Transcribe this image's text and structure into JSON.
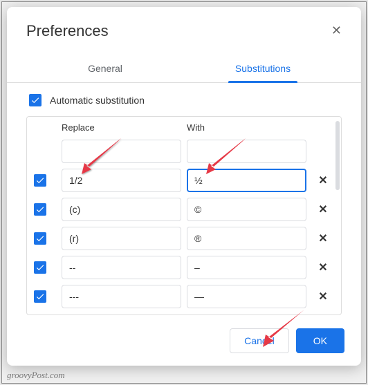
{
  "dialog": {
    "title": "Preferences"
  },
  "tabs": {
    "general": "General",
    "substitutions": "Substitutions"
  },
  "autoSubLabel": "Automatic substitution",
  "headers": {
    "replace": "Replace",
    "with": "With"
  },
  "rows": [
    {
      "enabled": false,
      "replace": "",
      "with": "",
      "deletable": false
    },
    {
      "enabled": true,
      "replace": "1/2",
      "with": "½",
      "deletable": true,
      "focused": true
    },
    {
      "enabled": true,
      "replace": "(c)",
      "with": "©",
      "deletable": true
    },
    {
      "enabled": true,
      "replace": "(r)",
      "with": "®",
      "deletable": true
    },
    {
      "enabled": true,
      "replace": "--",
      "with": "–",
      "deletable": true
    },
    {
      "enabled": true,
      "replace": "---",
      "with": "—",
      "deletable": true
    }
  ],
  "buttons": {
    "cancel": "Cancel",
    "ok": "OK"
  },
  "watermark": "groovyPost.com"
}
